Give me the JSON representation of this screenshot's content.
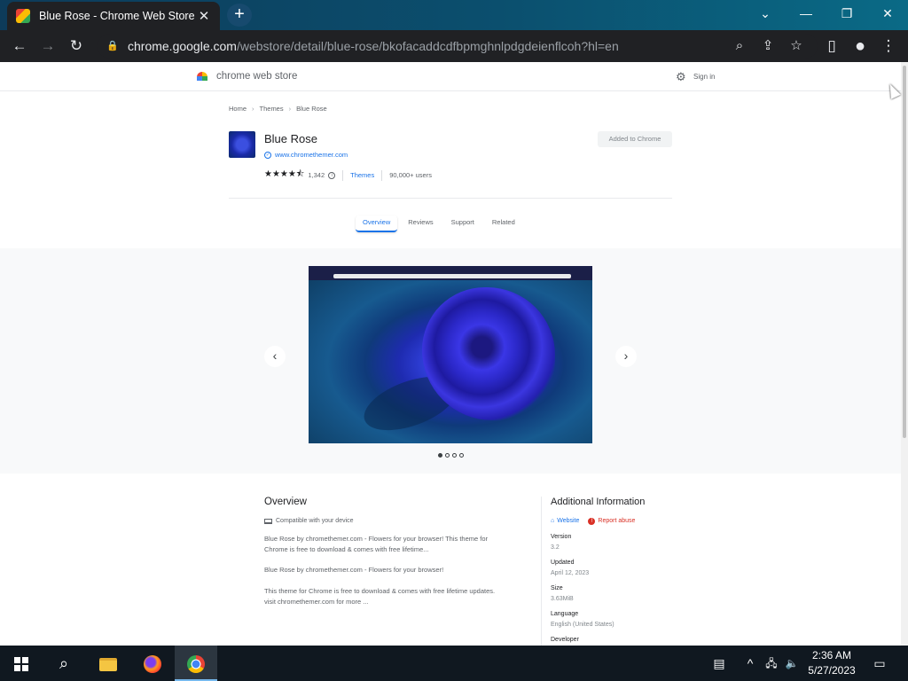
{
  "browser": {
    "tab_title": "Blue Rose - Chrome Web Store",
    "tab_close": "✕",
    "new_tab": "+",
    "url_host": "chrome.google.com",
    "url_path": "/webstore/detail/blue-rose/bkofacaddcdfbpmghnlpdgdeienflcoh?hl=en",
    "window_controls": {
      "tabsearch": "⌄",
      "minimize": "—",
      "restore": "❐",
      "close": "✕"
    },
    "nav": {
      "back": "←",
      "forward": "→",
      "reload": "↻"
    },
    "omni_icons": {
      "zoom": "⌕",
      "share": "⇪",
      "bookmark": "☆"
    },
    "toolbar_icons": {
      "sidepanel": "▯",
      "profile": "●",
      "menu": "⋮"
    }
  },
  "store": {
    "name": "chrome web store",
    "signin": "Sign in",
    "gear": "⚙"
  },
  "breadcrumb": [
    "Home",
    "Themes",
    "Blue Rose"
  ],
  "breadcrumb_sep": "›",
  "extension": {
    "title": "Blue Rose",
    "site": "www.chromethemer.com",
    "verified_mark": "✓",
    "stars": "★★★★⯪",
    "rating_value": 4.5,
    "rating_count": "1,342",
    "info_mark": "i",
    "category": "Themes",
    "users": "90,000+ users",
    "action_button": "Added to Chrome"
  },
  "tabs": [
    "Overview",
    "Reviews",
    "Support",
    "Related"
  ],
  "gallery": {
    "prev": "‹",
    "next": "›",
    "slide_count": 4,
    "active_slide": 1
  },
  "overview": {
    "title": "Overview",
    "compat": "Compatible with your device",
    "desc1": "Blue Rose by chromethemer.com - Flowers for your browser! This theme for Chrome is free to download & comes with free lifetime...",
    "desc2": "Blue Rose by  chromethemer.com  - Flowers for your browser!",
    "desc3": "This theme for Chrome is free to download & comes with free lifetime updates. visit chromethemer.com for more ..."
  },
  "additional": {
    "title": "Additional Information",
    "website": "Website",
    "report": "Report abuse",
    "home_mark": "⌂",
    "report_mark": "!",
    "version_label": "Version",
    "version": "3.2",
    "updated_label": "Updated",
    "updated": "April 12, 2023",
    "size_label": "Size",
    "size": "3.63MiB",
    "language_label": "Language",
    "language": "English (United States)",
    "developer_label": "Developer"
  },
  "taskbar": {
    "search": "⌕",
    "time": "2:36 AM",
    "date": "5/27/2023",
    "tray": {
      "news": "▤",
      "chevron": "^",
      "network": "🖧",
      "volume": "🔈",
      "notification": "▭"
    }
  },
  "colors": {
    "accent": "#1a73e8",
    "report": "#d93025",
    "tabstrip": "#0b4f6e",
    "toolbar": "#202124"
  }
}
